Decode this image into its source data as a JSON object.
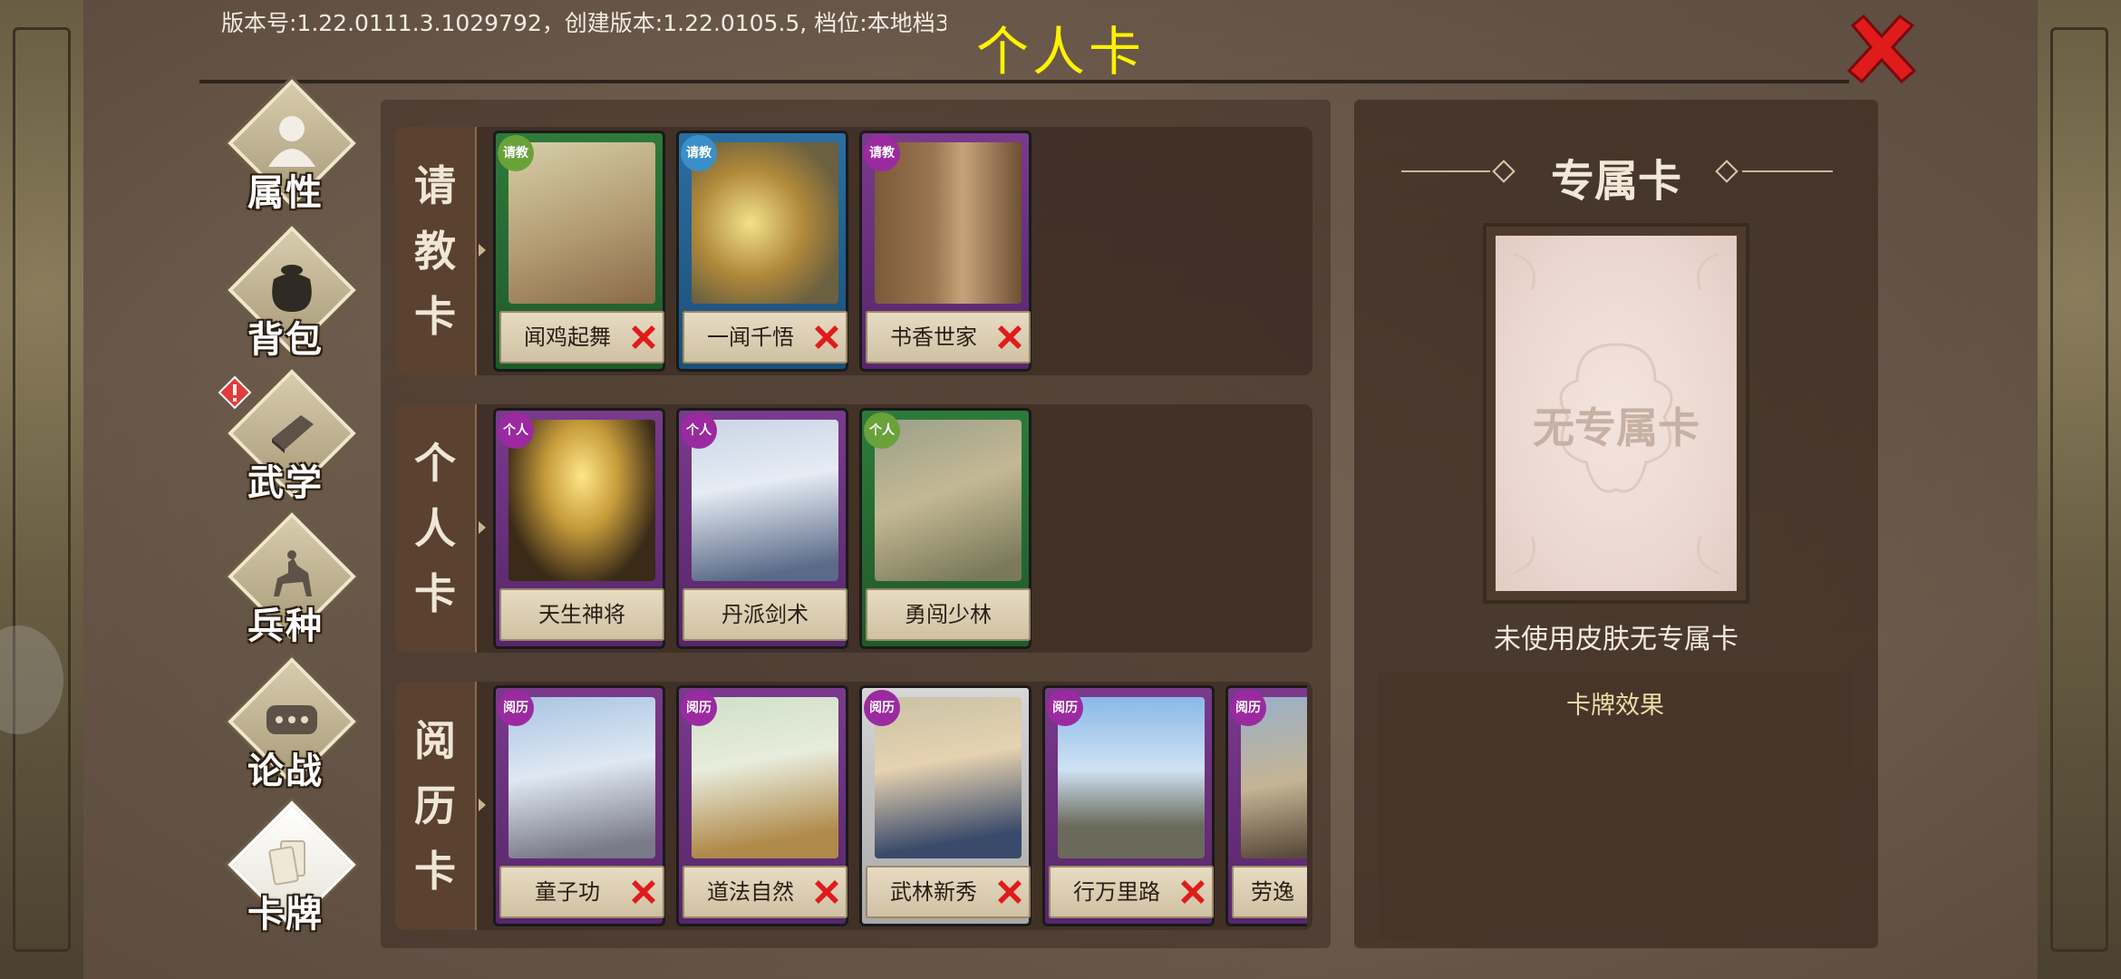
{
  "header": {
    "version": "版本号:1.22.0111.3.1029792，创建版本:1.22.0105.5, 档位:本地档3",
    "title": "个人卡"
  },
  "nav": {
    "items": [
      {
        "label": "属性",
        "icon": "person-icon"
      },
      {
        "label": "背包",
        "icon": "bag-icon"
      },
      {
        "label": "武学",
        "icon": "book-icon",
        "alert": true
      },
      {
        "label": "兵种",
        "icon": "cavalry-icon"
      },
      {
        "label": "论战",
        "icon": "chat-icon"
      },
      {
        "label": "卡牌",
        "icon": "cards-icon",
        "active": true
      }
    ]
  },
  "rows": [
    {
      "label": [
        "请",
        "教",
        "卡"
      ],
      "cards": [
        {
          "name": "闻鸡起舞",
          "badge": "请教",
          "removable": true
        },
        {
          "name": "一闻千悟",
          "badge": "请教",
          "removable": true
        },
        {
          "name": "书香世家",
          "badge": "请教",
          "removable": true
        }
      ]
    },
    {
      "label": [
        "个",
        "人",
        "卡"
      ],
      "cards": [
        {
          "name": "天生神将",
          "badge": "个人",
          "removable": false
        },
        {
          "name": "丹派剑术",
          "badge": "个人",
          "removable": false
        },
        {
          "name": "勇闯少林",
          "badge": "个人",
          "removable": false
        }
      ]
    },
    {
      "label": [
        "阅",
        "历",
        "卡"
      ],
      "cards": [
        {
          "name": "童子功",
          "badge": "阅历",
          "removable": true
        },
        {
          "name": "道法自然",
          "badge": "阅历",
          "removable": true
        },
        {
          "name": "武林新秀",
          "badge": "阅历",
          "removable": true
        },
        {
          "name": "行万里路",
          "badge": "阅历",
          "removable": true
        },
        {
          "name": "劳逸",
          "badge": "阅历",
          "removable": false
        }
      ]
    }
  ],
  "exclusive": {
    "title": "专属卡",
    "placeholder": "无专属卡",
    "note": "未使用皮肤无专属卡",
    "effect_title": "卡牌效果"
  },
  "colors": {
    "title": "#fff200",
    "close": "#e01b1b",
    "badge_request": "#6aa23a",
    "badge_personal": "#9b2aa0",
    "badge_experience": "#9b2aa0"
  }
}
